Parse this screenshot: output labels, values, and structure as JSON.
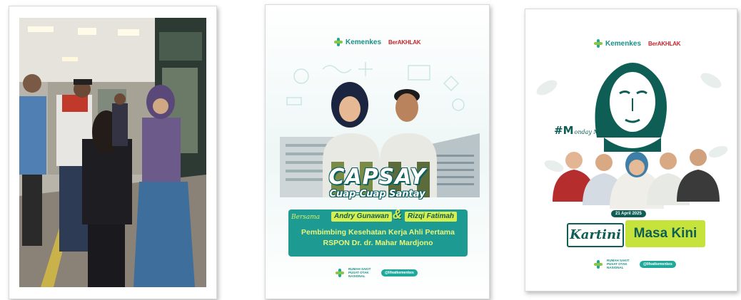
{
  "cards": {
    "capsay": {
      "brand_name": "Kemenkes",
      "brand_tag": "BerAKHLAK",
      "title": "CAPSAY",
      "subtitle": "Cuap-Cuap Santay",
      "with_label": "Bersama",
      "guest_1": "Andry Gunawan",
      "amp": "&",
      "guest_2": "Rizqi Fatimah",
      "role_line_1": "Pembimbing Kesehatan Kerja Ahli Pertama",
      "role_line_2": "RSPON Dr. dr. Mahar Mardjono",
      "footer_org": "RUMAH SAKIT PUSAT OTAK NASIONAL",
      "footer_handle": "@lifeatkemenkes"
    },
    "kartini": {
      "brand_name": "Kemenkes",
      "brand_tag": "BerAKHLAK",
      "hashtag": "#M",
      "hashtag_script": "onday Motivation",
      "date": "21 April 2025",
      "kartini_word": "Kartini",
      "masa_kini": "Masa Kini",
      "footer_org": "RUMAH SAKIT PUSAT OTAK NASIONAL",
      "footer_handle": "@lifeatkemenkes"
    }
  },
  "colors": {
    "teal": "#1d9a92",
    "dark_teal": "#0f5e56",
    "lime": "#c6e33b",
    "kemenkes_green": "#8cc63f",
    "berakhlak_red": "#c1272d"
  }
}
